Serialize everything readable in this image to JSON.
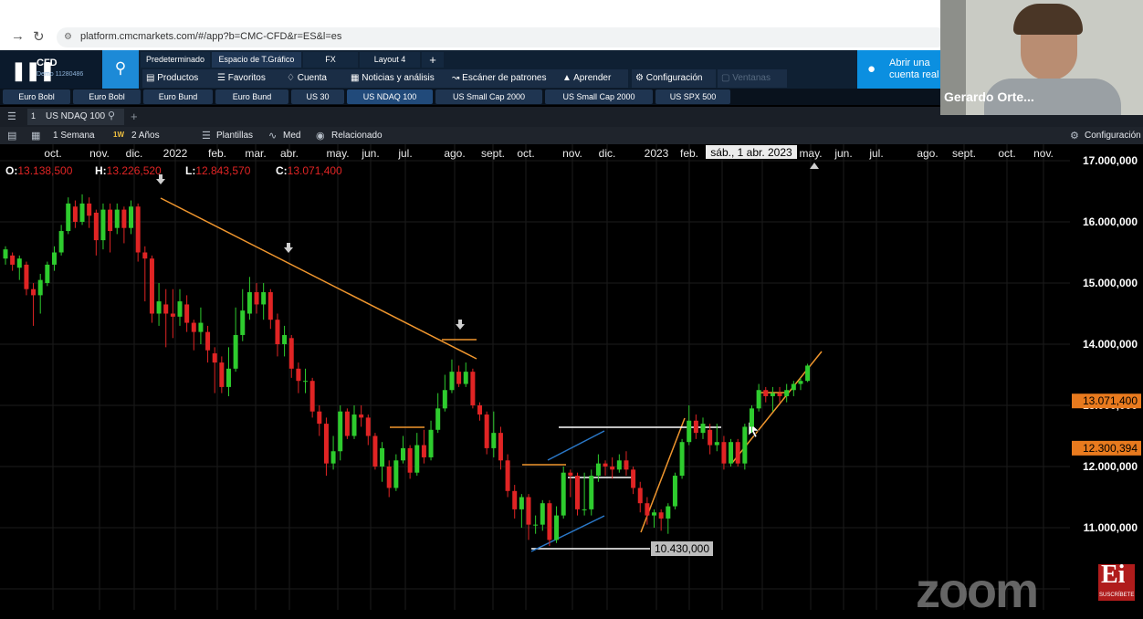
{
  "browser": {
    "url": "platform.cmcmarkets.com/#/app?b=CMC-CFD&r=ES&l=es"
  },
  "app": {
    "product": "CFD",
    "account": "Demo 11280486",
    "workspace_tabs": [
      "Predeterminado",
      "Espacio de T.Gráfico",
      "FX",
      "Layout 4",
      "+"
    ],
    "menu": [
      "Productos",
      "Favoritos",
      "Cuenta",
      "Noticias y análisis",
      "Escáner de patrones",
      "Aprender",
      "Configuración",
      "Ventanas"
    ],
    "open_account": "Abrir una cuenta real"
  },
  "instrument_tabs": [
    "Euro Bobl",
    "Euro Bobl",
    "Euro Bund",
    "Euro Bund",
    "US 30",
    "US NDAQ 100",
    "US Small Cap 2000",
    "US Small Cap 2000",
    "US SPX 500"
  ],
  "active_instrument": "US NDAQ 100",
  "chart_header": {
    "slot": "1",
    "instrument": "US NDAQ 100",
    "add": "+",
    "period": "1 Semana",
    "period_badge": "1W",
    "range": "2 Años",
    "templates": "Plantillas",
    "indicator": "Med",
    "related": "Relacionado",
    "settings": "Configuración"
  },
  "ohlc": {
    "o_label": "O:",
    "o": "13.138,500",
    "h_label": "H:",
    "h": "13.226,520",
    "l_label": "L:",
    "l": "12.843,570",
    "c_label": "C:",
    "c": "13.071,400"
  },
  "crosshair_date": "sáb., 1 abr. 2023",
  "x_labels": [
    "oct.",
    "nov.",
    "dic.",
    "2022",
    "feb.",
    "mar.",
    "abr.",
    "may.",
    "jun.",
    "jul.",
    "ago.",
    "sept.",
    "oct.",
    "nov.",
    "dic.",
    "2023",
    "feb.",
    "mar.",
    "abr.",
    "may.",
    "jun.",
    "jul.",
    "ago.",
    "sept.",
    "oct.",
    "nov."
  ],
  "price_axis": [
    "17.000,000",
    "16.000,000",
    "15.000,000",
    "14.000,000",
    "13.000,000",
    "12.000,000",
    "11.000,000"
  ],
  "price_tags": [
    "13.071,400",
    "12.300,394"
  ],
  "low_marker": "10.430,000",
  "webcam": {
    "name": "Gerardo Orte..."
  },
  "overlay": {
    "zoom": "zoom",
    "ei": "Ei",
    "ei_sub": "SUSCRÍBETE"
  },
  "colors": {
    "up": "#2ecc2e",
    "down": "#e02424",
    "trendline": "#f0962e",
    "grid": "#1b1b1b",
    "accent": "#1d8ad7"
  },
  "chart_data": {
    "type": "candlestick",
    "y_range": [
      10000,
      17000
    ],
    "x_range": [
      "2021-09",
      "2023-11"
    ],
    "trendlines": [
      {
        "from": [
          "2022-01",
          16300
        ],
        "to": [
          "2022-08",
          13400
        ]
      },
      {
        "from": [
          "2023-01",
          10900
        ],
        "to": [
          "2023-02",
          12400
        ]
      },
      {
        "from": [
          "2023-06",
          11900
        ],
        "to": [
          "2023-08",
          13400
        ]
      }
    ],
    "support_level": 10430,
    "candles": [
      {
        "o": 15400,
        "c": 15550,
        "h": 15600,
        "l": 15300
      },
      {
        "o": 15450,
        "c": 15300,
        "h": 15500,
        "l": 15200
      },
      {
        "o": 15250,
        "c": 15400,
        "h": 15450,
        "l": 15050
      },
      {
        "o": 15300,
        "c": 14900,
        "h": 15350,
        "l": 14800
      },
      {
        "o": 14900,
        "c": 14800,
        "h": 15000,
        "l": 14300
      },
      {
        "o": 14800,
        "c": 15050,
        "h": 15150,
        "l": 14500
      },
      {
        "o": 15000,
        "c": 15300,
        "h": 15350,
        "l": 14950
      },
      {
        "o": 15300,
        "c": 15500,
        "h": 15600,
        "l": 15200
      },
      {
        "o": 15500,
        "c": 15850,
        "h": 15950,
        "l": 15450
      },
      {
        "o": 15850,
        "c": 16300,
        "h": 16400,
        "l": 15800
      },
      {
        "o": 16250,
        "c": 16000,
        "h": 16350,
        "l": 15900
      },
      {
        "o": 16000,
        "c": 16300,
        "h": 16450,
        "l": 15950
      },
      {
        "o": 16300,
        "c": 16100,
        "h": 16400,
        "l": 15900
      },
      {
        "o": 16150,
        "c": 15700,
        "h": 16200,
        "l": 15450
      },
      {
        "o": 15700,
        "c": 16200,
        "h": 16300,
        "l": 15550
      },
      {
        "o": 16200,
        "c": 15850,
        "h": 16300,
        "l": 15500
      },
      {
        "o": 15900,
        "c": 16200,
        "h": 16300,
        "l": 15800
      },
      {
        "o": 16200,
        "c": 15900,
        "h": 16250,
        "l": 15650
      },
      {
        "o": 15900,
        "c": 16250,
        "h": 16350,
        "l": 15800
      },
      {
        "o": 16250,
        "c": 15500,
        "h": 16300,
        "l": 15350
      },
      {
        "o": 15500,
        "c": 15400,
        "h": 15600,
        "l": 14700
      },
      {
        "o": 15400,
        "c": 14500,
        "h": 15450,
        "l": 14350
      },
      {
        "o": 14500,
        "c": 14700,
        "h": 15000,
        "l": 14300
      },
      {
        "o": 14650,
        "c": 14500,
        "h": 14900,
        "l": 13950
      },
      {
        "o": 14500,
        "c": 14450,
        "h": 14900,
        "l": 14100
      },
      {
        "o": 14450,
        "c": 14700,
        "h": 14900,
        "l": 14300
      },
      {
        "o": 14650,
        "c": 14350,
        "h": 14800,
        "l": 14200
      },
      {
        "o": 14350,
        "c": 14200,
        "h": 14400,
        "l": 13900
      },
      {
        "o": 14200,
        "c": 14350,
        "h": 14600,
        "l": 14000
      },
      {
        "o": 14200,
        "c": 13900,
        "h": 14300,
        "l": 13700
      },
      {
        "o": 13850,
        "c": 13700,
        "h": 13950,
        "l": 13200
      },
      {
        "o": 13700,
        "c": 13300,
        "h": 13800,
        "l": 13200
      },
      {
        "o": 13300,
        "c": 13600,
        "h": 13950,
        "l": 13150
      },
      {
        "o": 13600,
        "c": 14150,
        "h": 14600,
        "l": 13550
      },
      {
        "o": 14150,
        "c": 14550,
        "h": 14900,
        "l": 14050
      },
      {
        "o": 14500,
        "c": 14850,
        "h": 15100,
        "l": 14400
      },
      {
        "o": 14850,
        "c": 14650,
        "h": 15000,
        "l": 14500
      },
      {
        "o": 14650,
        "c": 14850,
        "h": 15000,
        "l": 14400
      },
      {
        "o": 14850,
        "c": 14400,
        "h": 14900,
        "l": 14250
      },
      {
        "o": 14400,
        "c": 14000,
        "h": 14500,
        "l": 13800
      },
      {
        "o": 14000,
        "c": 14150,
        "h": 14300,
        "l": 13800
      },
      {
        "o": 14100,
        "c": 13600,
        "h": 14150,
        "l": 13450
      },
      {
        "o": 13600,
        "c": 13400,
        "h": 13700,
        "l": 13200
      },
      {
        "o": 13400,
        "c": 13400,
        "h": 13600,
        "l": 13200
      },
      {
        "o": 13400,
        "c": 12900,
        "h": 13450,
        "l": 12800
      },
      {
        "o": 12900,
        "c": 12700,
        "h": 13000,
        "l": 12500
      },
      {
        "o": 12700,
        "c": 12050,
        "h": 12800,
        "l": 11850
      },
      {
        "o": 12050,
        "c": 12250,
        "h": 12500,
        "l": 11950
      },
      {
        "o": 12250,
        "c": 12900,
        "h": 13000,
        "l": 12100
      },
      {
        "o": 12900,
        "c": 12500,
        "h": 12950,
        "l": 12450
      },
      {
        "o": 12500,
        "c": 12850,
        "h": 13000,
        "l": 12450
      },
      {
        "o": 12850,
        "c": 12800,
        "h": 13000,
        "l": 12650
      },
      {
        "o": 12800,
        "c": 12500,
        "h": 12850,
        "l": 12350
      },
      {
        "o": 12500,
        "c": 12000,
        "h": 12550,
        "l": 11950
      },
      {
        "o": 12000,
        "c": 12300,
        "h": 12400,
        "l": 11750
      },
      {
        "o": 12000,
        "c": 11650,
        "h": 12100,
        "l": 11500
      },
      {
        "o": 11650,
        "c": 12100,
        "h": 12200,
        "l": 11600
      },
      {
        "o": 12100,
        "c": 12300,
        "h": 12500,
        "l": 12050
      },
      {
        "o": 12300,
        "c": 11900,
        "h": 12350,
        "l": 11800
      },
      {
        "o": 11900,
        "c": 12350,
        "h": 12550,
        "l": 11850
      },
      {
        "o": 12350,
        "c": 12150,
        "h": 12600,
        "l": 12050
      },
      {
        "o": 12150,
        "c": 12600,
        "h": 12750,
        "l": 12100
      },
      {
        "o": 12600,
        "c": 12950,
        "h": 13200,
        "l": 12550
      },
      {
        "o": 12950,
        "c": 13250,
        "h": 13500,
        "l": 12900
      },
      {
        "o": 13250,
        "c": 13550,
        "h": 13750,
        "l": 13200
      },
      {
        "o": 13550,
        "c": 13350,
        "h": 13650,
        "l": 13300
      },
      {
        "o": 13350,
        "c": 13550,
        "h": 13700,
        "l": 13300
      },
      {
        "o": 13550,
        "c": 13000,
        "h": 13600,
        "l": 12950
      },
      {
        "o": 13000,
        "c": 12850,
        "h": 13050,
        "l": 12750
      },
      {
        "o": 12850,
        "c": 12300,
        "h": 12900,
        "l": 12200
      },
      {
        "o": 12300,
        "c": 12550,
        "h": 12900,
        "l": 12150
      },
      {
        "o": 12550,
        "c": 12100,
        "h": 12650,
        "l": 11950
      },
      {
        "o": 12100,
        "c": 11600,
        "h": 12200,
        "l": 11500
      },
      {
        "o": 11600,
        "c": 11300,
        "h": 11700,
        "l": 11150
      },
      {
        "o": 11300,
        "c": 11500,
        "h": 11550,
        "l": 11000
      },
      {
        "o": 11500,
        "c": 11050,
        "h": 11550,
        "l": 10800
      },
      {
        "o": 11050,
        "c": 11050,
        "h": 11200,
        "l": 10900
      },
      {
        "o": 11050,
        "c": 11400,
        "h": 11450,
        "l": 10950
      },
      {
        "o": 11400,
        "c": 10800,
        "h": 11450,
        "l": 10700
      },
      {
        "o": 10800,
        "c": 11200,
        "h": 11350,
        "l": 10750
      },
      {
        "o": 11200,
        "c": 11900,
        "h": 12000,
        "l": 11150
      },
      {
        "o": 11900,
        "c": 11850,
        "h": 11950,
        "l": 11500
      },
      {
        "o": 11850,
        "c": 11300,
        "h": 11900,
        "l": 11200
      },
      {
        "o": 11300,
        "c": 11300,
        "h": 11900,
        "l": 11200
      },
      {
        "o": 11300,
        "c": 11850,
        "h": 11950,
        "l": 11200
      },
      {
        "o": 11850,
        "c": 12050,
        "h": 12200,
        "l": 11750
      },
      {
        "o": 12050,
        "c": 12000,
        "h": 12100,
        "l": 11850
      },
      {
        "o": 12000,
        "c": 11950,
        "h": 12150,
        "l": 11800
      },
      {
        "o": 11950,
        "c": 12100,
        "h": 12200,
        "l": 11900
      },
      {
        "o": 12100,
        "c": 11950,
        "h": 12250,
        "l": 11850
      },
      {
        "o": 11950,
        "c": 11650,
        "h": 12000,
        "l": 11550
      },
      {
        "o": 11650,
        "c": 11400,
        "h": 11750,
        "l": 11250
      },
      {
        "o": 11400,
        "c": 11200,
        "h": 11500,
        "l": 11050
      },
      {
        "o": 11200,
        "c": 11250,
        "h": 11300,
        "l": 11000
      },
      {
        "o": 11250,
        "c": 11150,
        "h": 11300,
        "l": 10950
      },
      {
        "o": 11150,
        "c": 11350,
        "h": 11400,
        "l": 10900
      },
      {
        "o": 11350,
        "c": 11850,
        "h": 11900,
        "l": 11300
      },
      {
        "o": 11850,
        "c": 12400,
        "h": 12450,
        "l": 11800
      },
      {
        "o": 12400,
        "c": 12750,
        "h": 13000,
        "l": 12350
      },
      {
        "o": 12750,
        "c": 12550,
        "h": 12850,
        "l": 12450
      },
      {
        "o": 12550,
        "c": 12700,
        "h": 12800,
        "l": 12450
      },
      {
        "o": 12600,
        "c": 12350,
        "h": 12700,
        "l": 12200
      },
      {
        "o": 12350,
        "c": 12400,
        "h": 12700,
        "l": 12250
      },
      {
        "o": 12400,
        "c": 12050,
        "h": 12500,
        "l": 11950
      },
      {
        "o": 12050,
        "c": 12400,
        "h": 12450,
        "l": 12000
      },
      {
        "o": 12400,
        "c": 12050,
        "h": 12450,
        "l": 12000
      },
      {
        "o": 12050,
        "c": 12650,
        "h": 12700,
        "l": 11950
      },
      {
        "o": 12650,
        "c": 12950,
        "h": 13000,
        "l": 12550
      },
      {
        "o": 12950,
        "c": 13250,
        "h": 13350,
        "l": 12900
      },
      {
        "o": 13250,
        "c": 13150,
        "h": 13300,
        "l": 13050
      },
      {
        "o": 13150,
        "c": 13200,
        "h": 13300,
        "l": 12900
      },
      {
        "o": 13200,
        "c": 13150,
        "h": 13300,
        "l": 13050
      },
      {
        "o": 13150,
        "c": 13250,
        "h": 13350,
        "l": 13050
      },
      {
        "o": 13250,
        "c": 13350,
        "h": 13400,
        "l": 13150
      },
      {
        "o": 13350,
        "c": 13400,
        "h": 13450,
        "l": 13250
      },
      {
        "o": 13400,
        "c": 13650,
        "h": 13680,
        "l": 13380
      }
    ]
  }
}
